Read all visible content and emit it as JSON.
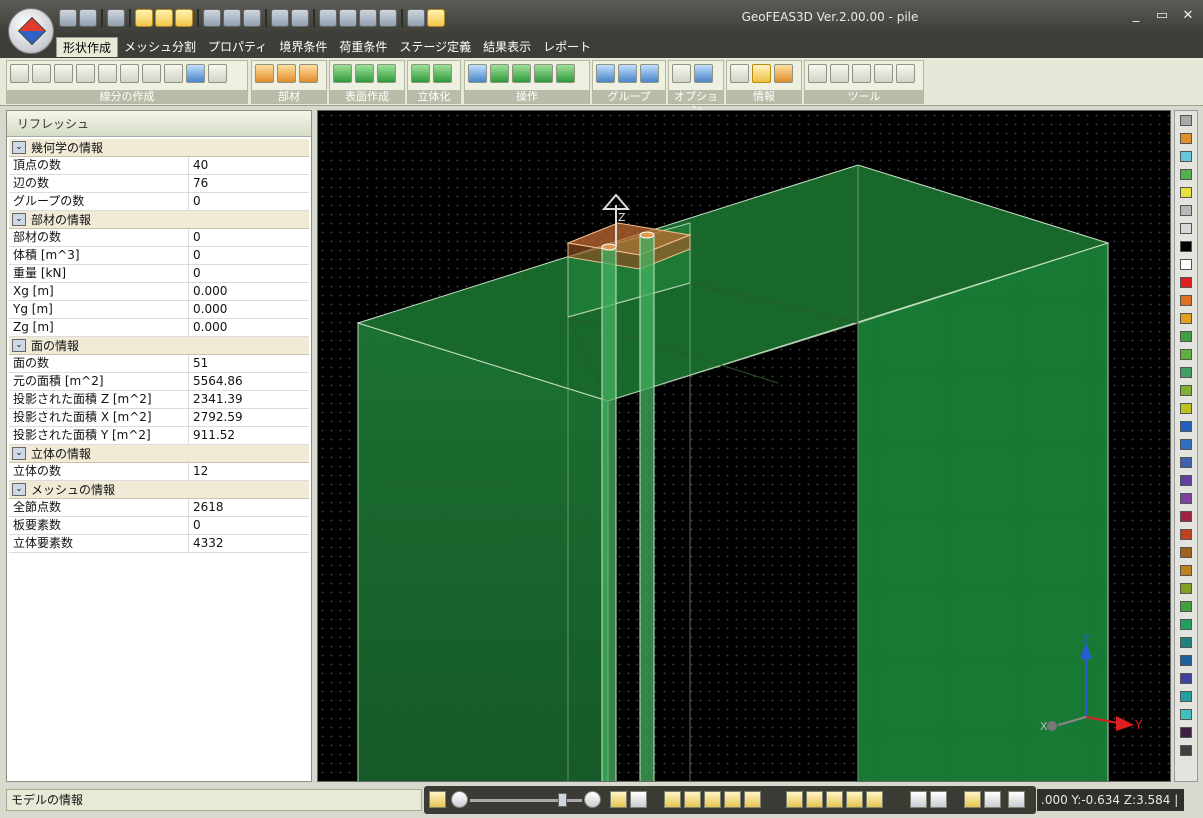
{
  "window": {
    "title": "GeoFEAS3D Ver.2.00.00 - pile",
    "controls": [
      "_",
      "▭",
      "✕"
    ]
  },
  "menu": [
    {
      "label": "形状作成",
      "active": true
    },
    {
      "label": "メッシュ分割"
    },
    {
      "label": "プロパティ"
    },
    {
      "label": "境界条件"
    },
    {
      "label": "荷重条件"
    },
    {
      "label": "ステージ定義"
    },
    {
      "label": "結果表示"
    },
    {
      "label": "レポート"
    }
  ],
  "ribbon": {
    "groups": [
      {
        "label": "線分の作成",
        "icons": [
          "polyline-icon",
          "line-icon",
          "arc-icon",
          "circle-icon",
          "ellipse-icon",
          "spline-icon",
          "split-icon",
          "intersect-icon",
          "grid-points-icon",
          "import-icon"
        ]
      },
      {
        "label": "部材",
        "icons": [
          "beam-icon",
          "beam-delete-icon",
          "beam-edit-icon"
        ]
      },
      {
        "label": "表面作成",
        "icons": [
          "surface-icon",
          "surface-extrude-icon",
          "surface-sweep-icon"
        ]
      },
      {
        "label": "立体化",
        "icons": [
          "solid-box-icon",
          "solid-wedge-icon"
        ]
      },
      {
        "label": "操作",
        "icons": [
          "transform-icon",
          "solid-copy-icon",
          "solid-rotate-icon",
          "solid-move-icon",
          "solid-join-icon"
        ]
      },
      {
        "label": "グループ",
        "icons": [
          "group-select-icon",
          "group-box-icon",
          "group-edit-icon"
        ]
      },
      {
        "label": "オプション",
        "icons": [
          "snap-icon",
          "grid-icon"
        ]
      },
      {
        "label": "情報",
        "icons": [
          "measure-icon",
          "model-info-icon",
          "pick-icon"
        ]
      },
      {
        "label": "ツール",
        "icons": [
          "eraser-icon",
          "undo-icon",
          "redo-icon",
          "settings-icon",
          "help-icon"
        ]
      }
    ]
  },
  "left_panel": {
    "refresh_label": "リフレッシュ",
    "sections": [
      {
        "title": "幾何学の情報",
        "rows": [
          {
            "key": "頂点の数",
            "value": "40"
          },
          {
            "key": "辺の数",
            "value": "76"
          },
          {
            "key": "グループの数",
            "value": "0"
          }
        ]
      },
      {
        "title": "部材の情報",
        "rows": [
          {
            "key": "部材の数",
            "value": "0"
          },
          {
            "key": "体積 [m^3]",
            "value": "0"
          },
          {
            "key": "重量 [kN]",
            "value": "0"
          },
          {
            "key": "Xg [m]",
            "value": "0.000"
          },
          {
            "key": "Yg [m]",
            "value": "0.000"
          },
          {
            "key": "Zg [m]",
            "value": "0.000"
          }
        ]
      },
      {
        "title": "面の情報",
        "rows": [
          {
            "key": "面の数",
            "value": "51"
          },
          {
            "key": "元の面積 [m^2]",
            "value": "5564.86"
          },
          {
            "key": "投影された面積 Z [m^2]",
            "value": "2341.39"
          },
          {
            "key": "投影された面積 X [m^2]",
            "value": "2792.59"
          },
          {
            "key": "投影された面積 Y [m^2]",
            "value": "911.52"
          }
        ]
      },
      {
        "title": "立体の情報",
        "rows": [
          {
            "key": "立体の数",
            "value": "12"
          }
        ]
      },
      {
        "title": "メッシュの情報",
        "rows": [
          {
            "key": "全節点数",
            "value": "2618"
          },
          {
            "key": "板要素数",
            "value": "0"
          },
          {
            "key": "立体要素数",
            "value": "4332"
          }
        ]
      }
    ]
  },
  "viewport": {
    "axis_labels": {
      "z": "Z",
      "x": "X",
      "y": "Y"
    },
    "gizmo_label": "Z"
  },
  "palette_colors": [
    "#a8a8a8",
    "#e0902a",
    "#64c8d8",
    "#50b050",
    "#e8e040",
    "#b8b8b8",
    "#d8d8d8",
    "#000000",
    "#ffffff",
    "#e02020",
    "#e07020",
    "#e0a020",
    "#40a040",
    "#60b040",
    "#40a060",
    "#80b030",
    "#c0c020",
    "#2060c0",
    "#3070c0",
    "#4060b0",
    "#6040a0",
    "#8040a0",
    "#a02040",
    "#c04020",
    "#a06020",
    "#c08020",
    "#80a020",
    "#40a040",
    "#20a060",
    "#208080",
    "#2060a0",
    "#4040a0",
    "#20a0a0",
    "#40c0c0",
    "#402040",
    "#404040"
  ],
  "status": {
    "model_info": "モデルの情報",
    "coords": ".000 Y:-0.634 Z:3.584 |"
  }
}
